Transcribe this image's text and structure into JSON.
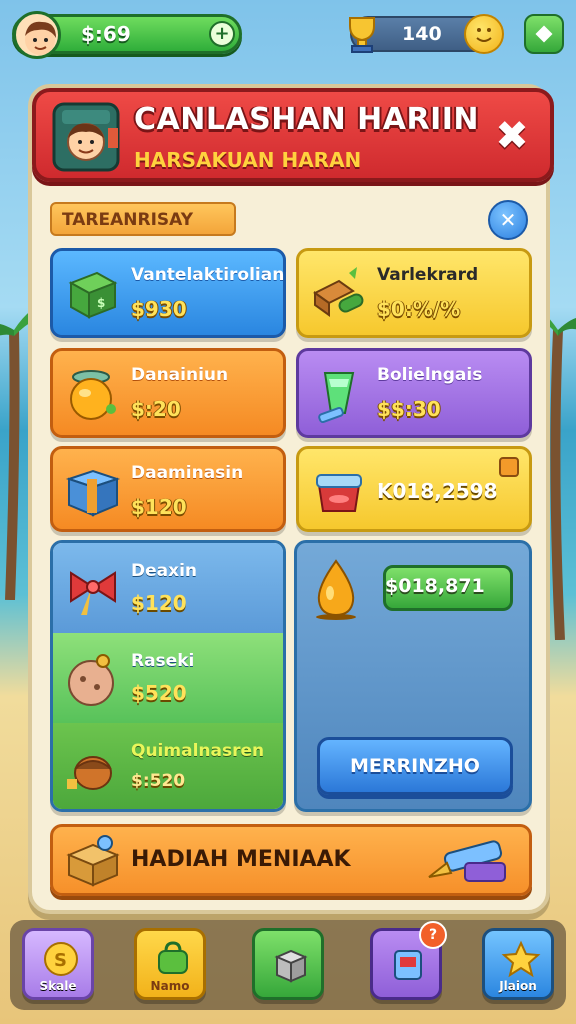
{
  "hud": {
    "cash": "$:69",
    "gems": "140"
  },
  "banner": {
    "title": "CANLASHAN HARIIN",
    "subtitle": "HARSAKUAN HARAN"
  },
  "section": {
    "label": "TAREANRISAY"
  },
  "cards": [
    {
      "name": "Vantelaktirolian",
      "price": "$930"
    },
    {
      "name": "Varlekrard",
      "price": "$0:%/%"
    },
    {
      "name": "Danainiun",
      "price": "$:20"
    },
    {
      "name": "Bolielngais",
      "price": "$$:30"
    },
    {
      "name": "Daaminasin",
      "price": "$120"
    },
    {
      "name": "",
      "price": "K018,2598"
    }
  ],
  "stack": [
    {
      "name": "Deaxin",
      "price": "$120"
    },
    {
      "name": "Raseki",
      "price": "$520"
    },
    {
      "name": "Quimalnasren",
      "price": "$:520"
    }
  ],
  "big_offer": {
    "price": "$018,871",
    "button": "MERRINZHO"
  },
  "reward": {
    "label": "HADIAH MENIAAK"
  },
  "nav": [
    {
      "label": "Skale"
    },
    {
      "label": "Namo"
    },
    {
      "label": ""
    },
    {
      "label": ""
    },
    {
      "label": "Jlaion"
    }
  ]
}
